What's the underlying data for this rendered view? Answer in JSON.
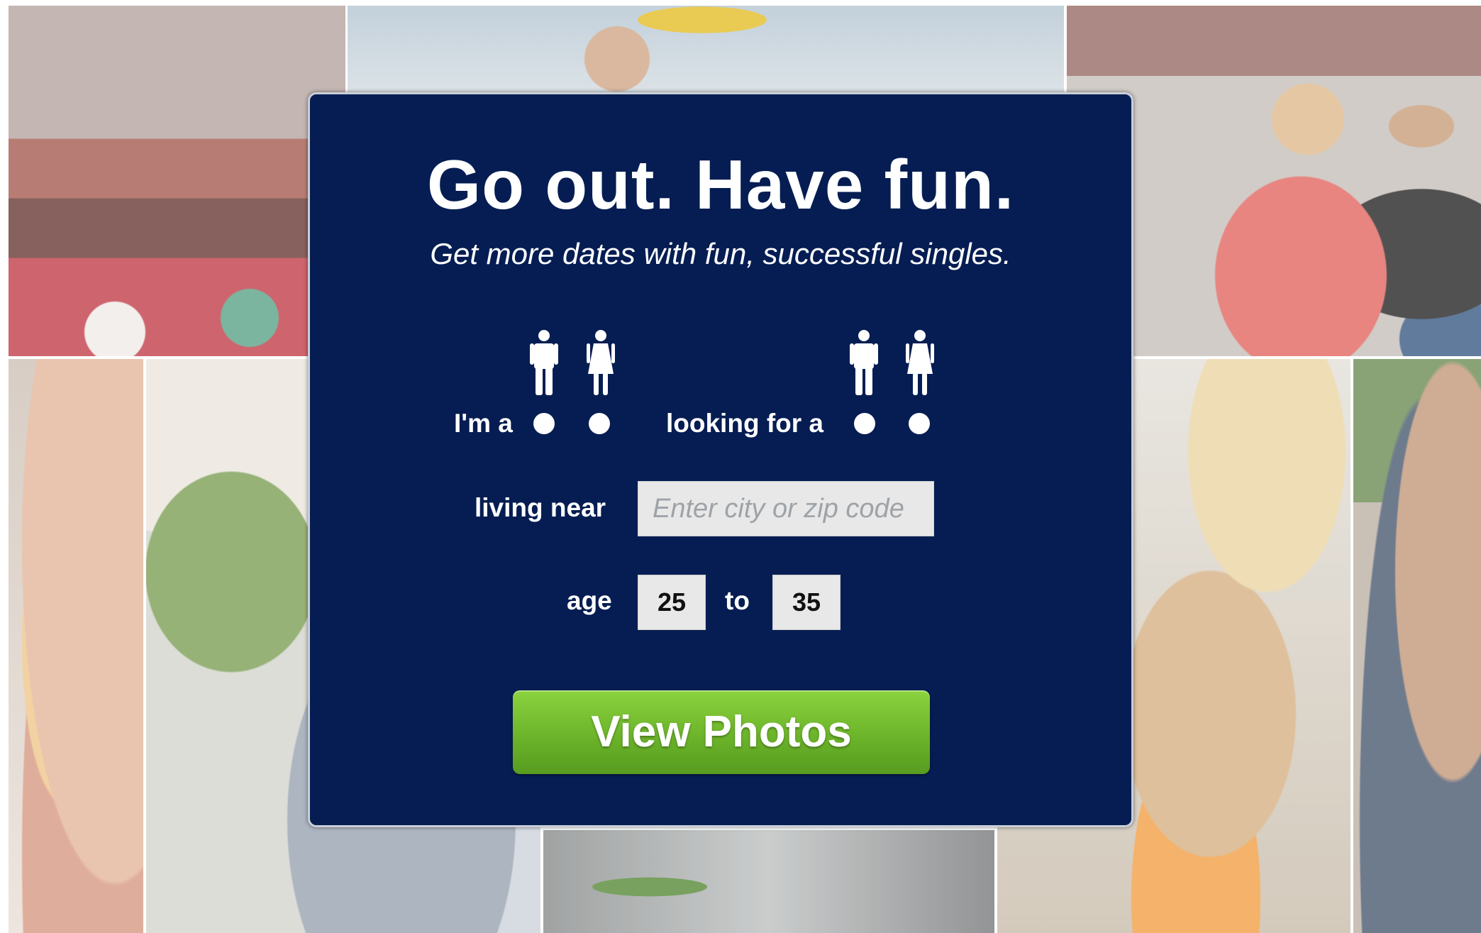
{
  "hero": {
    "headline": "Go out. Have fun.",
    "subheadline": "Get more dates with fun, successful singles."
  },
  "search_form": {
    "im_a_label": "I'm a",
    "looking_for_label": "looking for a",
    "gender_icons": [
      "male-icon",
      "female-icon"
    ],
    "living_near_label": "living near",
    "location_placeholder": "Enter city or zip code",
    "location_value": "",
    "age_label": "age",
    "age_min": "25",
    "age_to_label": "to",
    "age_max": "35",
    "submit_label": "View Photos"
  },
  "colors": {
    "panel_background": "#051d52",
    "button_green": "#6cb42a",
    "text": "#ffffff",
    "input_background": "#e8e8e8"
  }
}
